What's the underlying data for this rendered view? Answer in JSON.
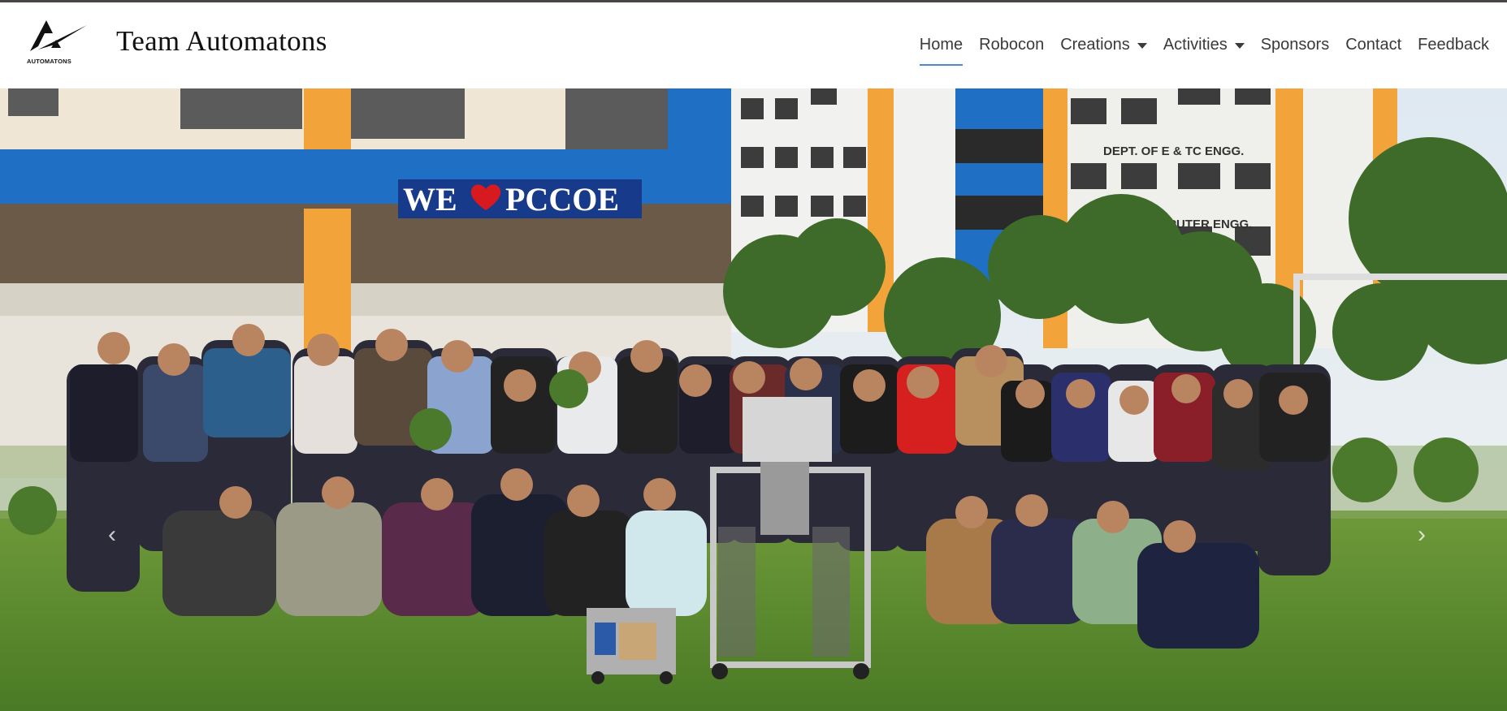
{
  "brand": {
    "name": "Team Automatons",
    "logo_text": "AUTOMATONS"
  },
  "nav": {
    "items": [
      {
        "label": "Home",
        "active": true
      },
      {
        "label": "Robocon"
      },
      {
        "label": "Creations",
        "dropdown": true
      },
      {
        "label": "Activities",
        "dropdown": true
      },
      {
        "label": "Sponsors"
      },
      {
        "label": "Contact"
      },
      {
        "label": "Feedback"
      }
    ]
  },
  "hero": {
    "building_sign": "WE ❤ PCCOE",
    "sign_left": "WE",
    "sign_right": "PCCOE",
    "dept_sign_1": "DEPT. OF E & TC ENGG.",
    "dept_sign_2": "OF COMPUTER ENGG.",
    "prev_icon": "chevron-left-icon",
    "next_icon": "chevron-right-icon"
  },
  "colors": {
    "accent": "#4a88d8",
    "building_blue": "#1f6fc4",
    "building_orange": "#f2a33a",
    "grass": "#5a8a2e"
  }
}
